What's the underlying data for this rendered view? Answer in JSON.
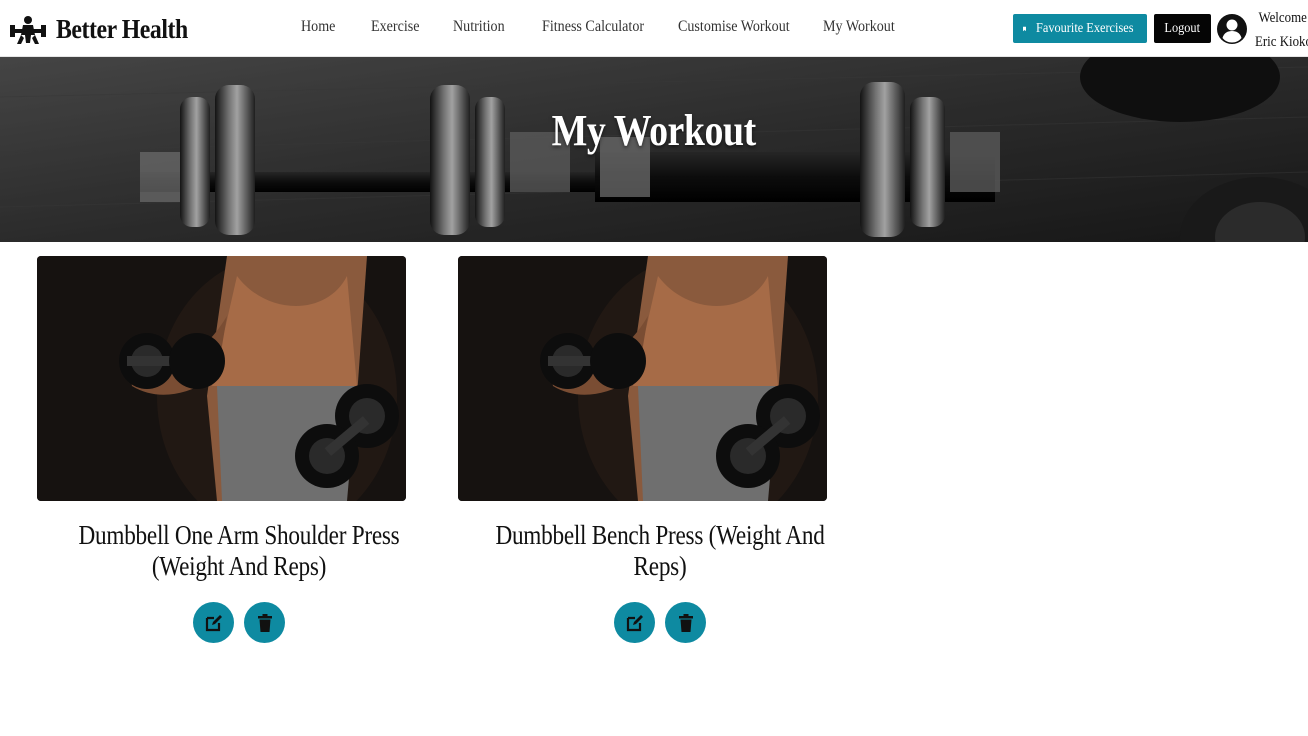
{
  "brand": {
    "name": "Better Health",
    "logo_icon": "dumbbell-logo-icon"
  },
  "nav": {
    "links": [
      "Home",
      "Exercise",
      "Nutrition",
      "Fitness Calculator",
      "Customise Workout",
      "My Workout"
    ]
  },
  "header_actions": {
    "favourites_label": "Favourite Exercises",
    "favourites_icon": "bookmark-icon",
    "logout_label": "Logout",
    "user_icon": "user-circle-icon",
    "welcome_line1": "Welcome",
    "welcome_line2": "Eric Kioko"
  },
  "hero": {
    "title": "My Workout"
  },
  "workouts": [
    {
      "title": "Dumbbell One Arm Shoulder Press (Weight And Reps)",
      "edit_icon": "edit-icon",
      "delete_icon": "trash-icon"
    },
    {
      "title": "Dumbbell Bench Press (Weight And Reps)",
      "edit_icon": "edit-icon",
      "delete_icon": "trash-icon"
    }
  ],
  "colors": {
    "accent": "#0e8aa1",
    "dark": "#050505"
  }
}
